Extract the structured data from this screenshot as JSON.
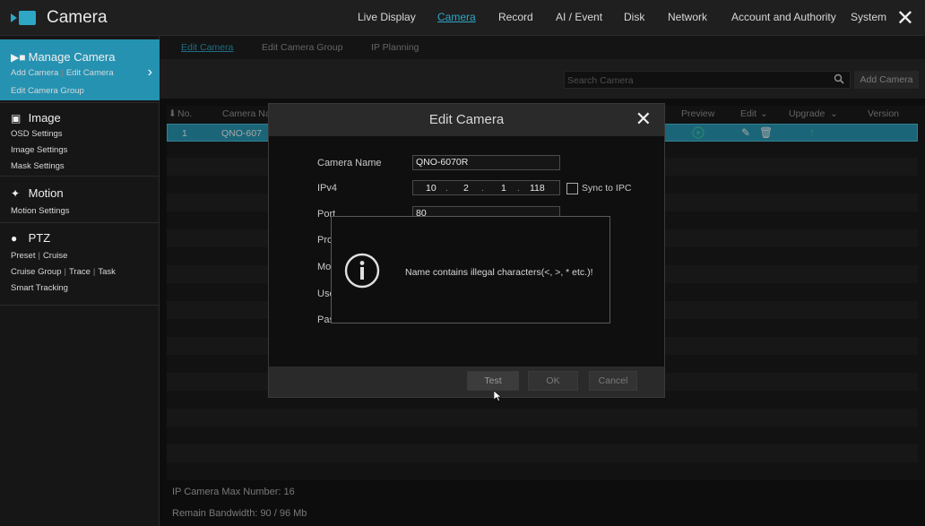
{
  "app": {
    "title": "Camera"
  },
  "topnav": [
    "Live Display",
    "Camera",
    "Record",
    "AI / Event",
    "Disk",
    "Network",
    "Account and Authority",
    "System"
  ],
  "sidebar": {
    "manage": {
      "title": "Manage Camera",
      "sub1a": "Add Camera",
      "sub1b": "Edit Camera",
      "sub2": "Edit Camera Group"
    },
    "image": {
      "title": "Image",
      "items": [
        "OSD Settings",
        "Image Settings",
        "Mask Settings"
      ]
    },
    "motion": {
      "title": "Motion",
      "items": [
        "Motion Settings"
      ]
    },
    "ptz": {
      "title": "PTZ",
      "l1a": "Preset",
      "l1b": "Cruise",
      "l2a": "Cruise Group",
      "l2b": "Trace",
      "l2c": "Task",
      "l3": "Smart Tracking"
    }
  },
  "subtabs": [
    "Edit Camera",
    "Edit Camera Group",
    "IP Planning"
  ],
  "search": {
    "placeholder": "Search Camera"
  },
  "toolbar": {
    "add_label": "Add Camera"
  },
  "table": {
    "headers": {
      "no": "No.",
      "name": "Camera Na",
      "preview": "Preview",
      "edit": "Edit",
      "upgrade": "Upgrade",
      "version": "Version"
    },
    "rows": [
      {
        "no": "1",
        "name": "QNO-607"
      }
    ]
  },
  "footer": {
    "max": "IP Camera Max Number: 16",
    "bandwidth": "Remain Bandwidth: 90 / 96 Mb"
  },
  "dialog": {
    "title": "Edit Camera",
    "labels": {
      "name": "Camera Name",
      "ipv4": "IPv4",
      "port": "Port",
      "proto": "Pro",
      "model": "Mo",
      "user": "Use",
      "pass": "Pas"
    },
    "name_value": "QNO-6070R",
    "ip": [
      "10",
      "2",
      "1",
      "118"
    ],
    "port_value": "80",
    "sync_label": "Sync to IPC",
    "buttons": {
      "test": "Test",
      "ok": "OK",
      "cancel": "Cancel"
    }
  },
  "message": {
    "text": "Name contains illegal characters(<,  >,  * etc.)!"
  },
  "colors": {
    "accent": "#2ea6c6",
    "selected_row": "#2a9cbb"
  }
}
